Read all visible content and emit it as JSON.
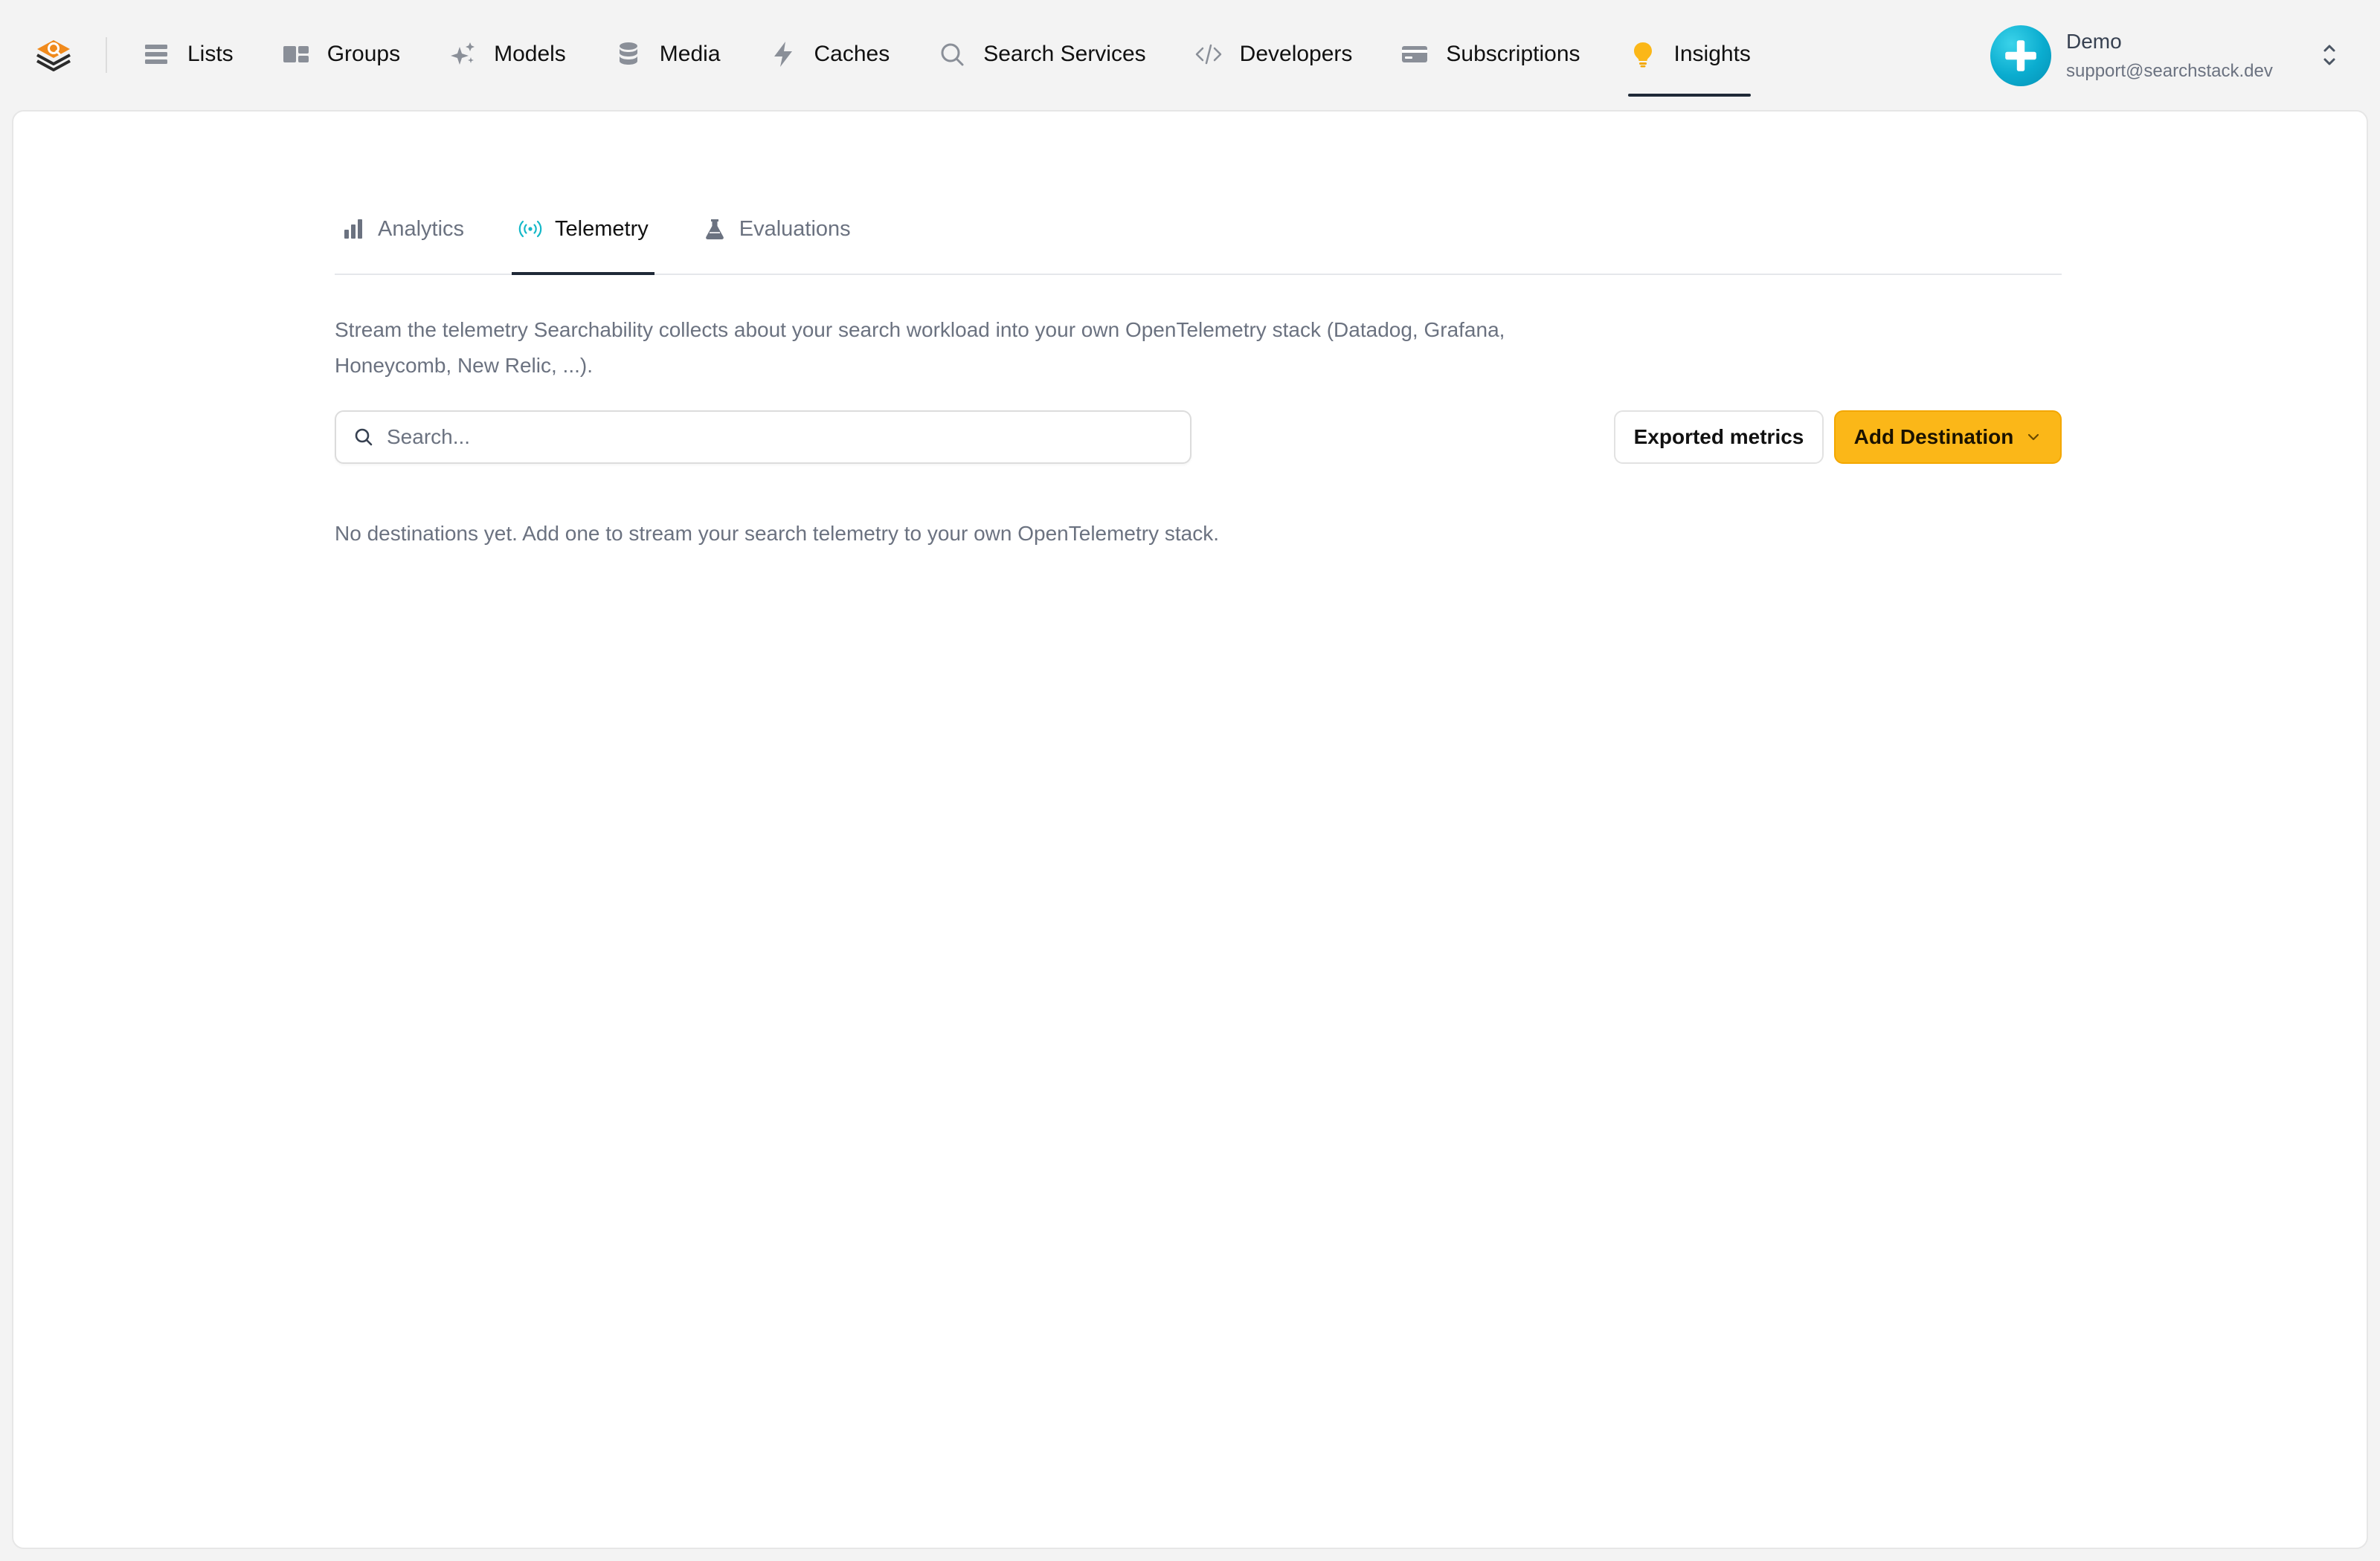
{
  "nav": {
    "items": [
      {
        "label": "Lists",
        "icon": "list-icon"
      },
      {
        "label": "Groups",
        "icon": "groups-icon"
      },
      {
        "label": "Models",
        "icon": "sparkles-icon"
      },
      {
        "label": "Media",
        "icon": "database-icon"
      },
      {
        "label": "Caches",
        "icon": "lightning-icon"
      },
      {
        "label": "Search Services",
        "icon": "search-icon"
      },
      {
        "label": "Developers",
        "icon": "code-icon"
      },
      {
        "label": "Subscriptions",
        "icon": "credit-card-icon"
      },
      {
        "label": "Insights",
        "icon": "lightbulb-icon",
        "active": true
      }
    ]
  },
  "user": {
    "name": "Demo",
    "email": "support@searchstack.dev"
  },
  "tabs": [
    {
      "label": "Analytics",
      "icon": "bar-chart-icon"
    },
    {
      "label": "Telemetry",
      "icon": "broadcast-icon",
      "active": true
    },
    {
      "label": "Evaluations",
      "icon": "flask-icon"
    }
  ],
  "telemetry": {
    "description": "Stream the telemetry Searchability collects about your search workload into your own OpenTelemetry stack (Datadog, Grafana, Honeycomb, New Relic, ...).",
    "search_placeholder": "Search...",
    "exported_metrics_label": "Exported metrics",
    "add_destination_label": "Add Destination",
    "empty_state": "No destinations yet. Add one to stream your search telemetry to your own OpenTelemetry stack."
  },
  "colors": {
    "accent": "#fbb718",
    "telemetry_icon": "#14b8c8",
    "avatar": "#0aaccf",
    "logo": "#f08a1c"
  }
}
